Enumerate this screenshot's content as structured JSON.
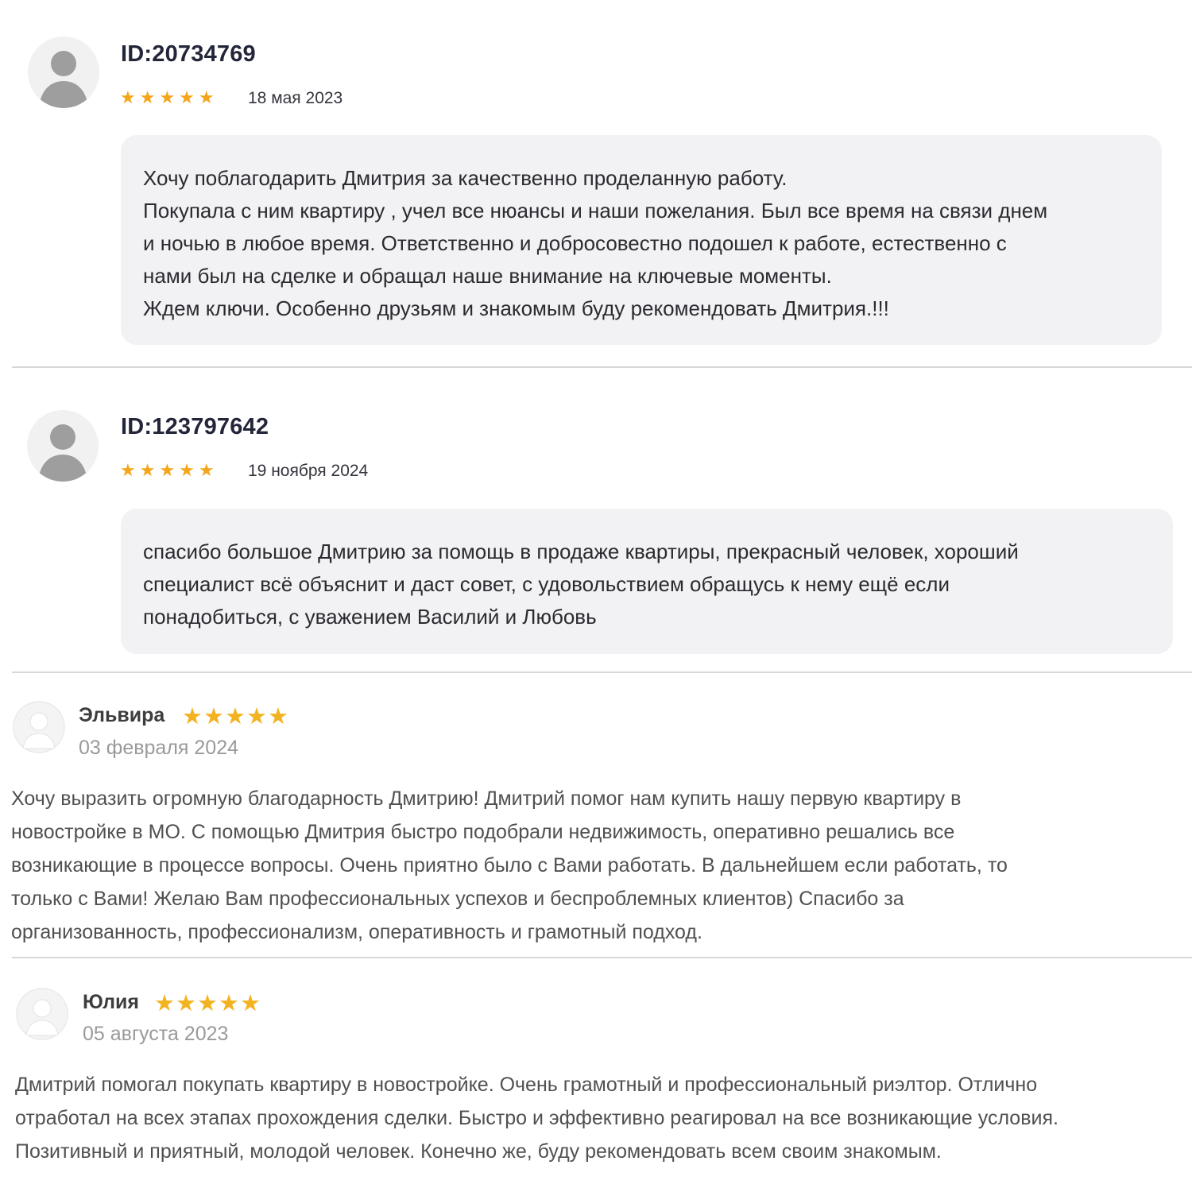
{
  "reviews": [
    {
      "author": "ID:20734769",
      "stars": "★★★★★",
      "rating": 5,
      "date": "18 мая 2023",
      "text": "Хочу поблагодарить Дмитрия за качественно проделанную работу.\nПокупала с ним квартиру , учел все нюансы и наши пожелания. Был все время на связи днем\nи ночью в любое время. Ответственно и добросовестно подошел к работе, естественно с\nнами был на сделке и обращал наше внимание на ключевые моменты.\nЖдем ключи. Особенно друзьям и знакомым буду рекомендовать Дмитрия.!!!"
    },
    {
      "author": "ID:123797642",
      "stars": "★★★★★",
      "rating": 5,
      "date": "19 ноября 2024",
      "text": "спасибо большое Дмитрию за помощь в продаже квартиры, прекрасный человек, хороший\nспециалист всё объяснит и даст совет, с удовольствием обращусь к нему ещё если\nпонадобиться, с уважением Василий и Любовь"
    },
    {
      "author": "Эльвира",
      "stars": "★★★★★",
      "rating": 5,
      "date": "03 февраля 2024",
      "text": "Хочу выразить огромную благодарность Дмитрию! Дмитрий помог нам купить нашу первую квартиру в\nновостройке в МО. С помощью Дмитрия быстро подобрали недвижимость, оперативно решались все\nвозникающие в процессе вопросы. Очень приятно было с Вами работать. В дальнейшем если работать, то\nтолько с Вами! Желаю Вам профессиональных успехов и беспроблемных клиентов) Спасибо за\nорганизованность, профессионализм, оперативность и грамотный подход."
    },
    {
      "author": "Юлия",
      "stars": "★★★★★",
      "rating": 5,
      "date": "05 августа 2023",
      "text": "Дмитрий помогал покупать квартиру в новостройке. Очень грамотный и профессиональный риэлтор. Отлично\nотработал на всех этапах прохождения сделки. Быстро и эффективно реагировал на все возникающие условия.\nПозитивный и приятный, молодой человек. Конечно же, буду рекомендовать всем своим знакомым."
    }
  ],
  "colors": {
    "star_gold": "#f4a519",
    "bubble_bg": "#f2f2f4",
    "divider": "#d7d7d7"
  },
  "icons": {
    "avatar": "user-placeholder-icon",
    "rating": "star-icon"
  }
}
